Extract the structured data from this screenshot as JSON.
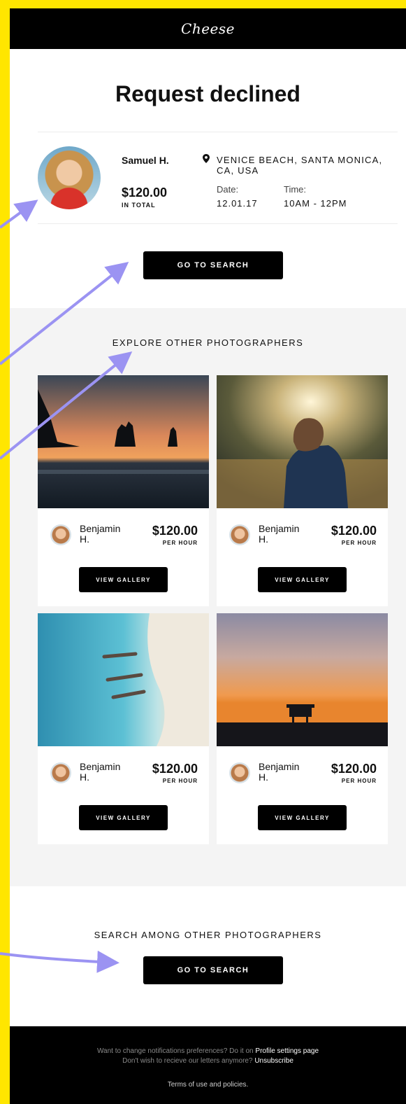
{
  "header": {
    "logo": "Cheese"
  },
  "page": {
    "title": "Request declined"
  },
  "booking": {
    "name": "Samuel H.",
    "price": "$120.00",
    "price_note": "IN TOTAL",
    "location": "VENICE BEACH, SANTA MONICA, CA, USA",
    "date_label": "Date:",
    "date_value": "12.01.17",
    "time_label": "Time:",
    "time_value": "10AM - 12PM",
    "cta": "GO TO SEARCH"
  },
  "explore": {
    "title": "EXPLORE OTHER PHOTOGRAPHERS",
    "cards": [
      {
        "name": "Benjamin H.",
        "price": "$120.00",
        "unit": "PER HOUR",
        "button": "VIEW GALLERY",
        "image": "sea-stacks-sunset"
      },
      {
        "name": "Benjamin H.",
        "price": "$120.00",
        "unit": "PER HOUR",
        "button": "VIEW GALLERY",
        "image": "man-backlit-portrait"
      },
      {
        "name": "Benjamin H.",
        "price": "$120.00",
        "unit": "PER HOUR",
        "button": "VIEW GALLERY",
        "image": "aerial-beach-swimmers"
      },
      {
        "name": "Benjamin H.",
        "price": "$120.00",
        "unit": "PER HOUR",
        "button": "VIEW GALLERY",
        "image": "lifeguard-tower-sunset"
      }
    ]
  },
  "search_section": {
    "title": "SEARCH AMONG OTHER PHOTOGRAPHERS",
    "cta": "GO TO SEARCH"
  },
  "footer": {
    "line1_text": "Want to change notifications preferences? Do it on ",
    "line1_link": "Profile settings page",
    "line2_text": "Don't wish to recieve our letters anymore? ",
    "line2_link": "Unsubscribe",
    "terms": "Terms of use and policies."
  },
  "colors": {
    "frame": "#FFE600",
    "annotation_arrow": "#9B93F2",
    "button": "#000000"
  }
}
